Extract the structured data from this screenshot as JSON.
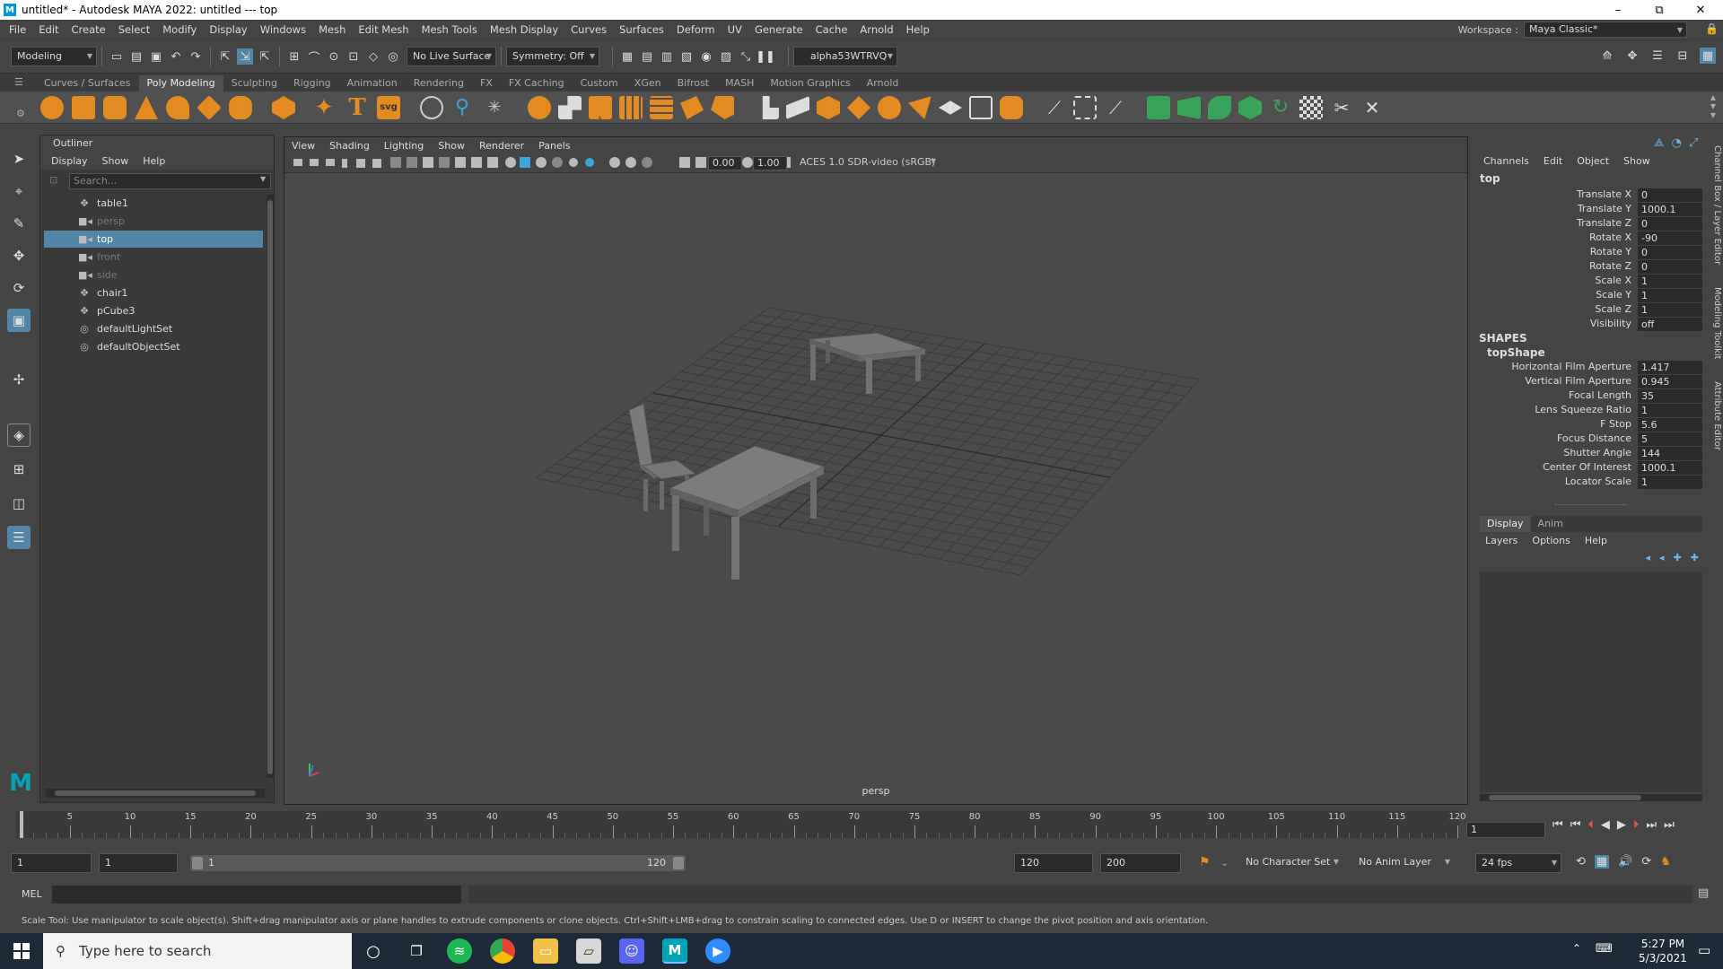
{
  "titlebar": {
    "title": "untitled* - Autodesk MAYA 2022: untitled   ---   top",
    "minimize": "–",
    "maximize": "⧉",
    "close": "✕"
  },
  "menubar": {
    "items": [
      "File",
      "Edit",
      "Create",
      "Select",
      "Modify",
      "Display",
      "Windows",
      "Mesh",
      "Edit Mesh",
      "Mesh Tools",
      "Mesh Display",
      "Curves",
      "Surfaces",
      "Deform",
      "UV",
      "Generate",
      "Cache",
      "Arnold",
      "Help"
    ],
    "workspace_label": "Workspace :",
    "workspace_value": "Maya Classic*"
  },
  "statusline": {
    "menuset": "Modeling",
    "live_surface": "No Live Surface",
    "symmetry": "Symmetry: Off",
    "user": "alpha53WTRVQ"
  },
  "shelf": {
    "tabs": [
      "Curves / Surfaces",
      "Poly Modeling",
      "Sculpting",
      "Rigging",
      "Animation",
      "Rendering",
      "FX",
      "FX Caching",
      "Custom",
      "XGen",
      "Bifrost",
      "MASH",
      "Motion Graphics",
      "Arnold"
    ],
    "active_tab": "Poly Modeling",
    "svg_label": "svg"
  },
  "outliner": {
    "title": "Outliner",
    "menu": [
      "Display",
      "Show",
      "Help"
    ],
    "search_placeholder": "Search...",
    "items": [
      {
        "label": "table1",
        "icon": "transform-icon",
        "state": "normal"
      },
      {
        "label": "persp",
        "icon": "camera-icon",
        "state": "dim"
      },
      {
        "label": "top",
        "icon": "camera-icon",
        "state": "selected"
      },
      {
        "label": "front",
        "icon": "camera-icon",
        "state": "dim"
      },
      {
        "label": "side",
        "icon": "camera-icon",
        "state": "dim"
      },
      {
        "label": "chair1",
        "icon": "transform-icon",
        "state": "normal"
      },
      {
        "label": "pCube3",
        "icon": "transform-icon",
        "state": "normal"
      },
      {
        "label": "defaultLightSet",
        "icon": "set-icon",
        "state": "normal"
      },
      {
        "label": "defaultObjectSet",
        "icon": "set-icon",
        "state": "normal"
      }
    ]
  },
  "viewport": {
    "menu": [
      "View",
      "Shading",
      "Lighting",
      "Show",
      "Renderer",
      "Panels"
    ],
    "near_value": "0.00",
    "far_value": "1.00",
    "color_space": "ACES 1.0 SDR-video (sRGB)",
    "camera_label": "persp"
  },
  "channelbox": {
    "menu": [
      "Channels",
      "Edit",
      "Object",
      "Show"
    ],
    "object": "top",
    "attributes": [
      {
        "name": "Translate X",
        "value": "0"
      },
      {
        "name": "Translate Y",
        "value": "1000.1"
      },
      {
        "name": "Translate Z",
        "value": "0"
      },
      {
        "name": "Rotate X",
        "value": "-90"
      },
      {
        "name": "Rotate Y",
        "value": "0"
      },
      {
        "name": "Rotate Z",
        "value": "0"
      },
      {
        "name": "Scale X",
        "value": "1"
      },
      {
        "name": "Scale Y",
        "value": "1"
      },
      {
        "name": "Scale Z",
        "value": "1"
      },
      {
        "name": "Visibility",
        "value": "off"
      }
    ],
    "shapes_header": "SHAPES",
    "shape_name": "topShape",
    "shape_attributes": [
      {
        "name": "Horizontal Film Aperture",
        "value": "1.417"
      },
      {
        "name": "Vertical Film Aperture",
        "value": "0.945"
      },
      {
        "name": "Focal Length",
        "value": "35"
      },
      {
        "name": "Lens Squeeze Ratio",
        "value": "1"
      },
      {
        "name": "F Stop",
        "value": "5.6"
      },
      {
        "name": "Focus Distance",
        "value": "5"
      },
      {
        "name": "Shutter Angle",
        "value": "144"
      },
      {
        "name": "Center Of Interest",
        "value": "1000.1"
      },
      {
        "name": "Locator Scale",
        "value": "1"
      }
    ],
    "layer_tabs": [
      "Display",
      "Anim"
    ],
    "layer_menu": [
      "Layers",
      "Options",
      "Help"
    ]
  },
  "side_tabs": [
    "Channel Box / Layer Editor",
    "Modeling Toolkit",
    "Attribute Editor"
  ],
  "timeline": {
    "ticks": [
      1,
      5,
      10,
      15,
      20,
      25,
      30,
      35,
      40,
      45,
      50,
      55,
      60,
      65,
      70,
      75,
      80,
      85,
      90,
      95,
      100,
      105,
      110,
      115,
      120
    ],
    "current_frame": "1"
  },
  "range": {
    "start": "1",
    "playback_start": "1",
    "bar_start": "1",
    "bar_end": "120",
    "playback_end": "120",
    "end": "200",
    "character_set": "No Character Set",
    "anim_layer": "No Anim Layer",
    "fps": "24 fps"
  },
  "commandline": {
    "label": "MEL"
  },
  "helpline": {
    "text": "Scale Tool: Use manipulator to scale object(s). Shift+drag manipulator axis or plane handles to extrude components or clone objects. Ctrl+Shift+LMB+drag to constrain scaling to connected edges. Use D or INSERT to change the pivot position and axis orientation."
  },
  "taskbar": {
    "search_placeholder": "Type here to search",
    "time": "5:27 PM",
    "date": "5/3/2021"
  },
  "colors": {
    "selection": "#5285a6",
    "panel": "#444444",
    "viewport": "#4a4a4a",
    "maya_teal": "#00a5b5",
    "shelf_orange": "#e38a20",
    "shelf_green": "#3aa35a"
  }
}
